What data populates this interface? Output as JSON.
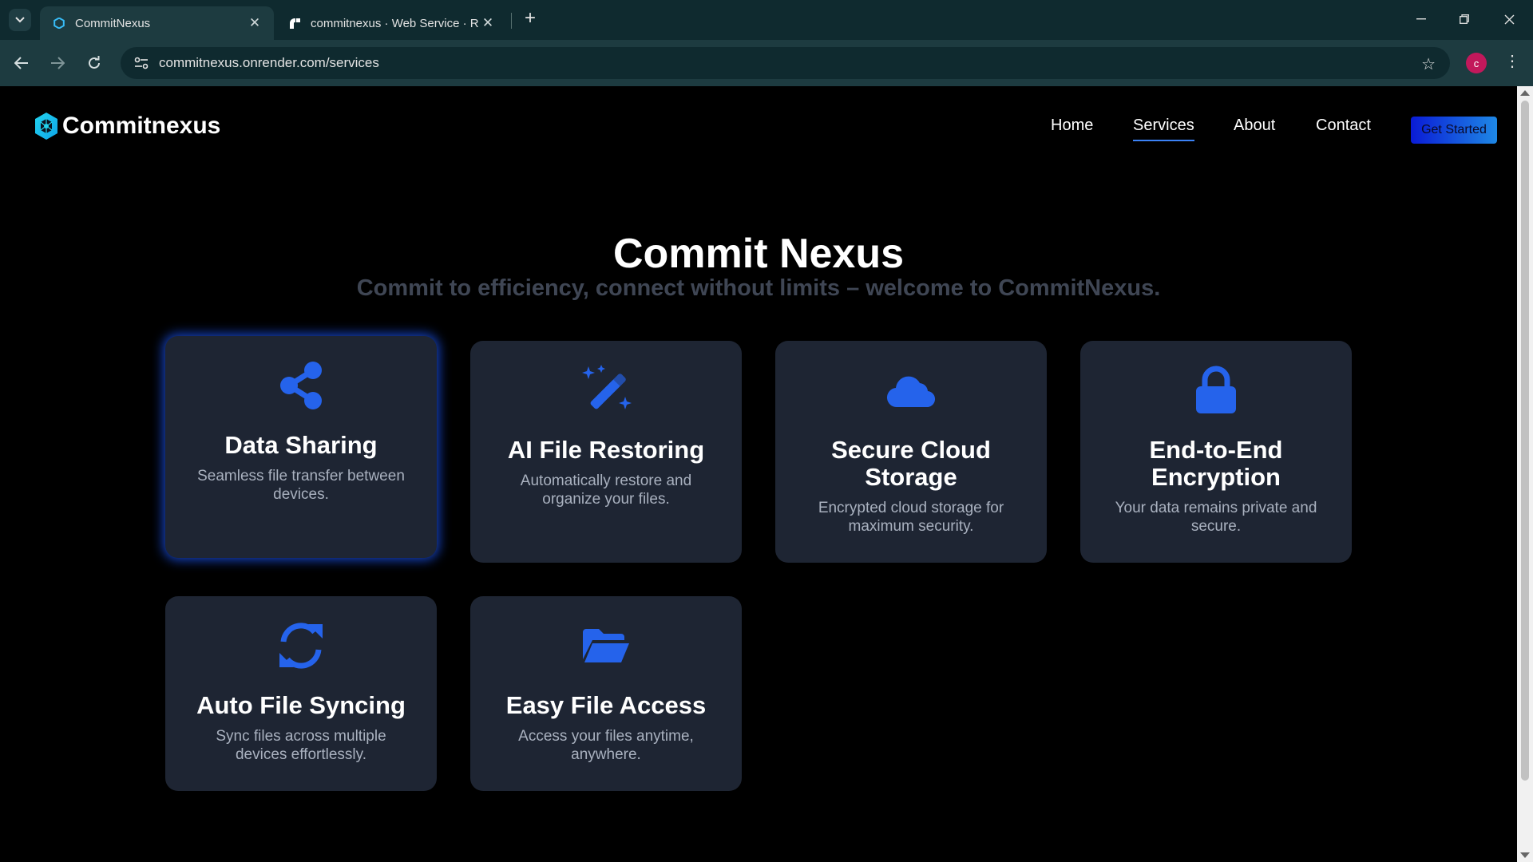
{
  "browser": {
    "tabs": [
      {
        "title": "CommitNexus",
        "active": true
      },
      {
        "title": "commitnexus · Web Service · R",
        "active": false
      }
    ],
    "url": "commitnexus.onrender.com/services",
    "profile_initial": "c"
  },
  "site": {
    "logo": "Commitnexus",
    "nav": [
      "Home",
      "Services",
      "About",
      "Contact"
    ],
    "active_nav": "Services",
    "cta": "Get Started"
  },
  "hero": {
    "title": "Commit Nexus",
    "subtitle": "Commit to efficiency, connect without limits – welcome to CommitNexus."
  },
  "services": [
    {
      "icon": "share-icon",
      "title": "Data Sharing",
      "description": "Seamless file transfer between devices."
    },
    {
      "icon": "magic-wand-icon",
      "title": "AI File Restoring",
      "description": "Automatically restore and organize your files."
    },
    {
      "icon": "cloud-icon",
      "title": "Secure Cloud Storage",
      "description": "Encrypted cloud storage for maximum security."
    },
    {
      "icon": "lock-icon",
      "title": "End-to-End Encryption",
      "description": "Your data remains private and secure."
    },
    {
      "icon": "sync-icon",
      "title": "Auto File Syncing",
      "description": "Sync files across multiple devices effortlessly."
    },
    {
      "icon": "folder-open-icon",
      "title": "Easy File Access",
      "description": "Access your files anytime, anywhere."
    }
  ],
  "colors": {
    "accent": "#2563eb",
    "card_bg": "#1e2533",
    "page_bg": "#000000"
  }
}
